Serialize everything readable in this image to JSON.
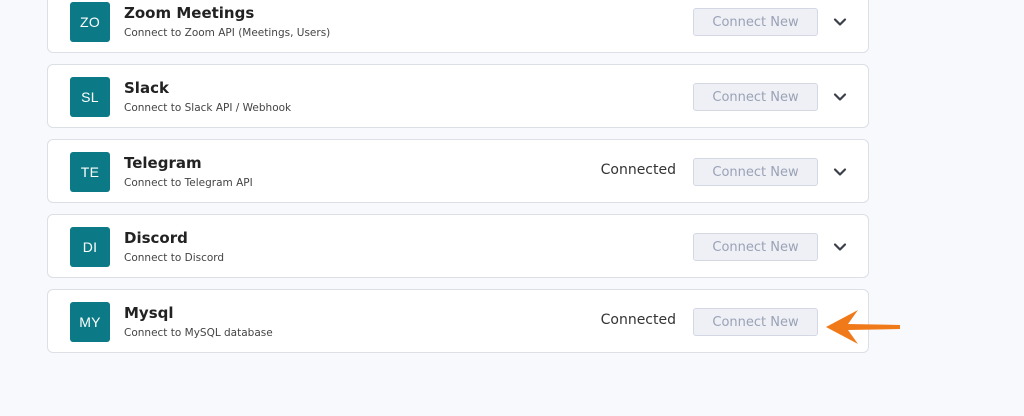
{
  "colors": {
    "avatar_bg": "#0b7a86",
    "button_bg": "#eef0f6",
    "button_text": "#9aa2b5",
    "arrow": "#f07a1a"
  },
  "integrations": [
    {
      "initials": "ZO",
      "name": "Zoom Meetings",
      "description": "Connect to Zoom API (Meetings, Users)",
      "status": "",
      "button_label": "Connect New",
      "expand_icon": "chevron-down-icon"
    },
    {
      "initials": "SL",
      "name": "Slack",
      "description": "Connect to Slack API / Webhook",
      "status": "",
      "button_label": "Connect New",
      "expand_icon": "chevron-down-icon"
    },
    {
      "initials": "TE",
      "name": "Telegram",
      "description": "Connect to Telegram API",
      "status": "Connected",
      "button_label": "Connect New",
      "expand_icon": "chevron-down-icon"
    },
    {
      "initials": "DI",
      "name": "Discord",
      "description": "Connect to Discord",
      "status": "",
      "button_label": "Connect New",
      "expand_icon": "chevron-down-icon"
    },
    {
      "initials": "MY",
      "name": "Mysql",
      "description": "Connect to MySQL database",
      "status": "Connected",
      "button_label": "Connect New",
      "expand_icon": ""
    }
  ],
  "annotation": {
    "icon": "arrow-left-icon"
  }
}
